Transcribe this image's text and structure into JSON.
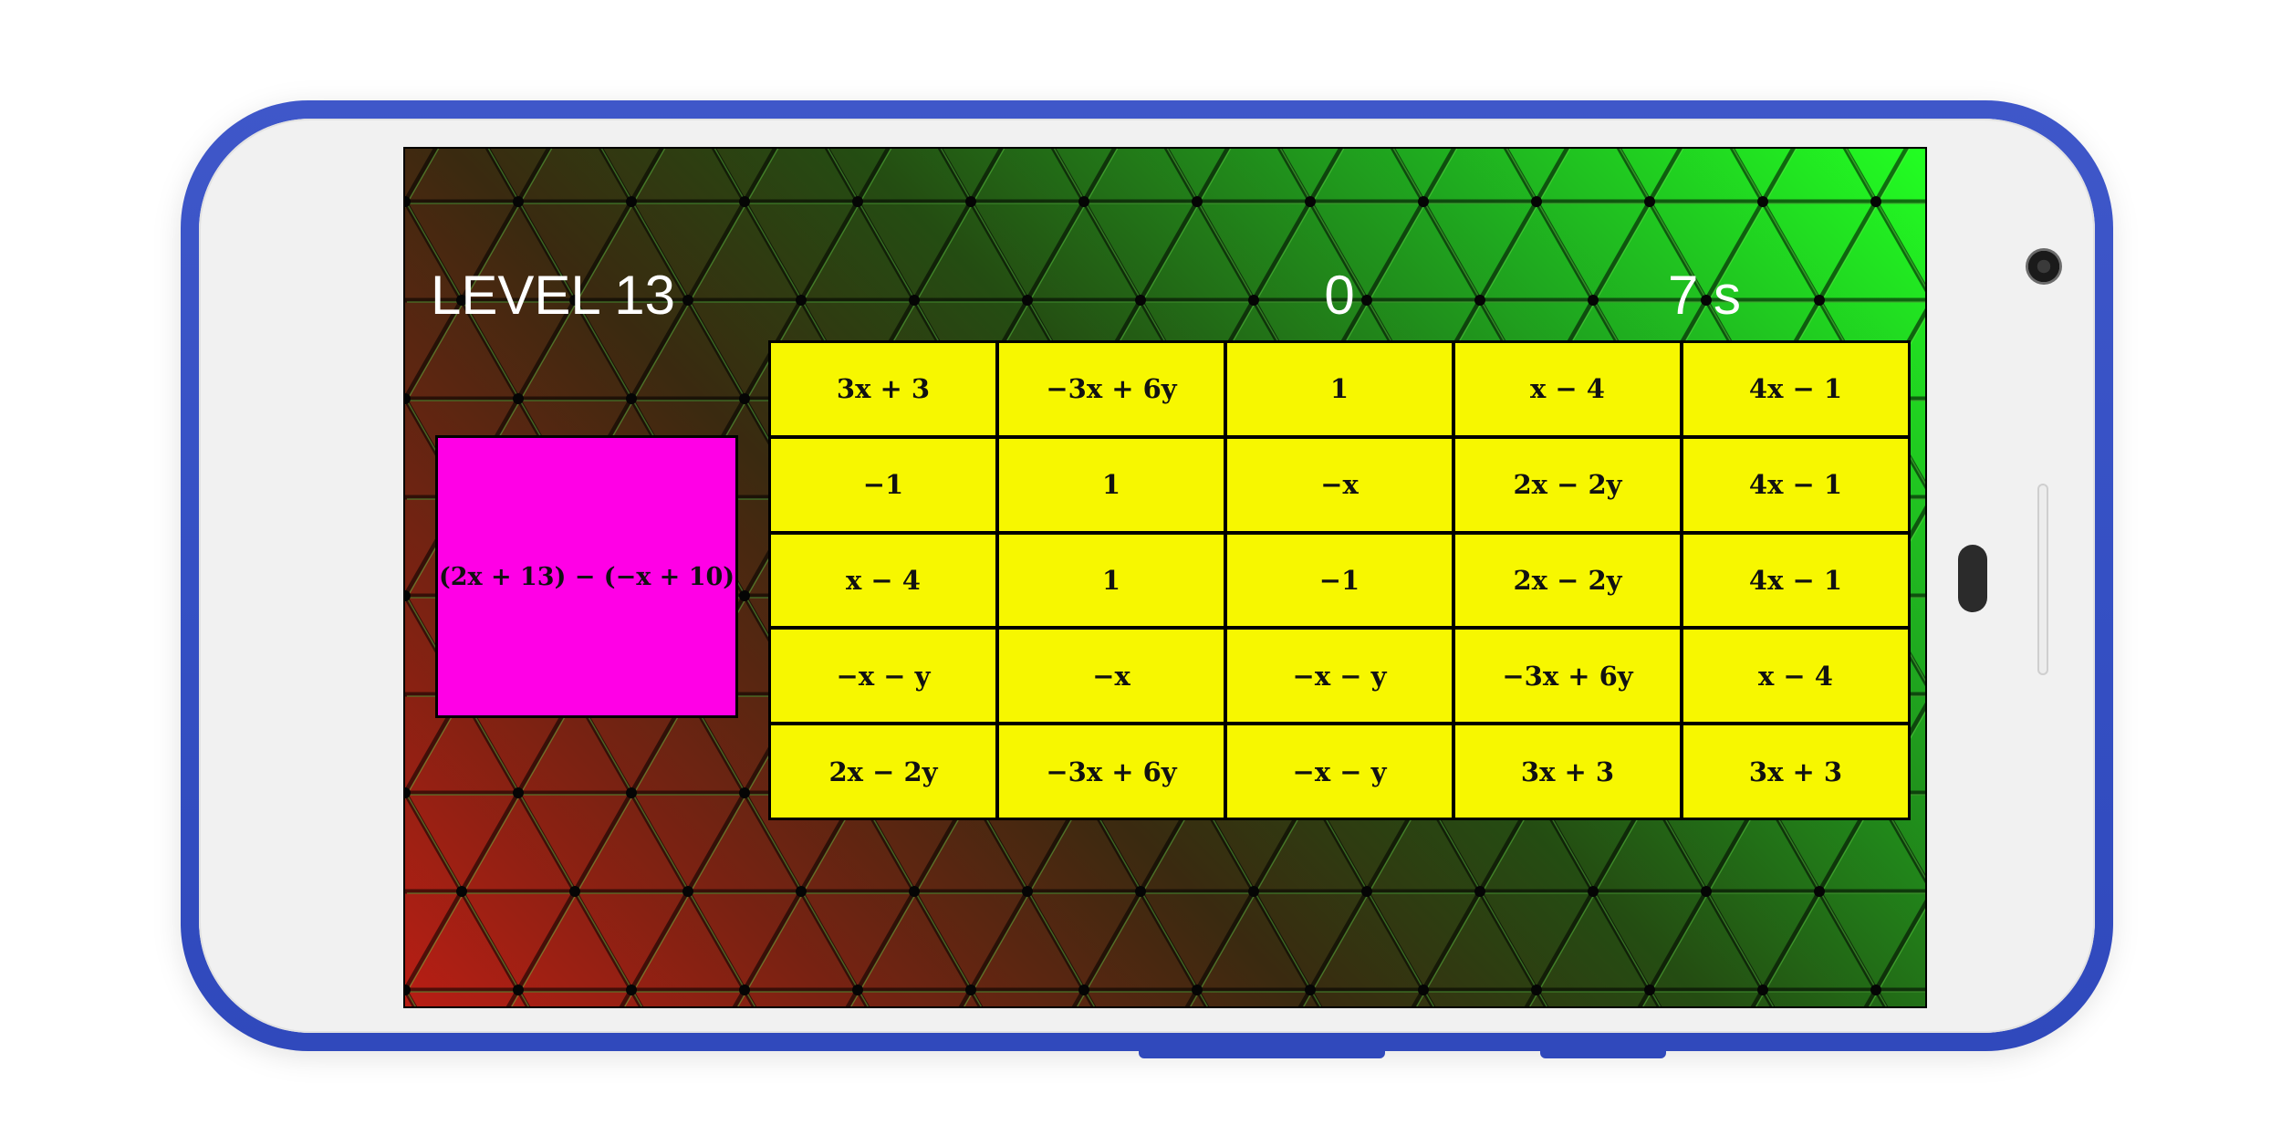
{
  "game": {
    "level_label": "LEVEL 13",
    "score": "0",
    "timer": "7 s",
    "question": "(2x + 13) − (−x + 10)"
  },
  "answers": [
    [
      "3x + 3",
      "−3x + 6y",
      "1",
      "x − 4",
      "4x − 1"
    ],
    [
      "−1",
      "1",
      "−x",
      "2x − 2y",
      "4x − 1"
    ],
    [
      "x − 4",
      "1",
      "−1",
      "2x − 2y",
      "4x − 1"
    ],
    [
      "−x − y",
      "−x",
      "−x − y",
      "−3x + 6y",
      "x − 4"
    ],
    [
      "2x − 2y",
      "−3x + 6y",
      "−x − y",
      "3x + 3",
      "3x + 3"
    ]
  ],
  "colors": {
    "phone_frame": "#3550c4",
    "question_card": "#ff00e6",
    "answer_cell": "#f7f700",
    "hud_text": "#ffffff"
  },
  "icons": {
    "camera": "front-camera-icon",
    "home": "home-button-icon"
  }
}
